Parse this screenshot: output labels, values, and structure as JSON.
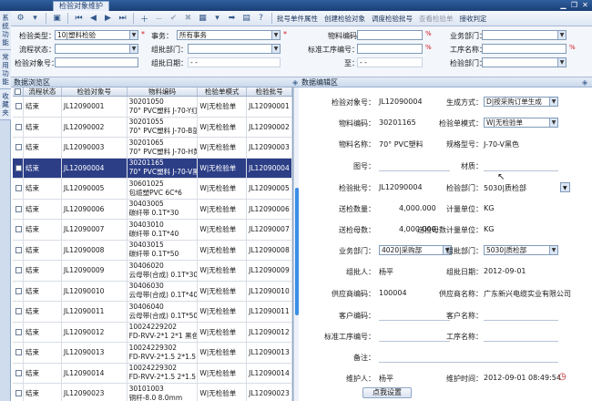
{
  "window": {
    "tab_title": "检验对象维护"
  },
  "sidebar": {
    "tabs": [
      "系统功能",
      "常用功能",
      "收藏夹"
    ]
  },
  "toolbar": {
    "texts": [
      "批号单件属性",
      "创建检验对象",
      "调度检验批号",
      "查看检验单",
      "接收判定"
    ]
  },
  "filter": {
    "labels": {
      "type": "检验类型：",
      "item": "事务：",
      "material_code": "物料编码：",
      "business_dept": "业务部门：",
      "flow_status": "流程状态：",
      "group_dept": "组批部门：",
      "std_process": "标准工序编号：",
      "process_name": "工序名称：",
      "object_no": "检验对象号：",
      "group_date": "组批日期：",
      "to": "至：",
      "check_dept": "检验部门："
    },
    "values": {
      "type": "10|塑料检验",
      "item": "所有事务",
      "date_from": "- -",
      "date_to": "- -"
    }
  },
  "panels": {
    "grid_title": "数据浏览区",
    "edit_title": "数据编辑区"
  },
  "grid": {
    "headers": [
      "流程状态",
      "检验对象号",
      "物料编码",
      "检验单模式",
      "检验批号"
    ],
    "rows": [
      {
        "status": "结束",
        "obj": "JL12090001",
        "mat1": "30201050",
        "mat2": "70° PVC塑料 J-70-Y红色",
        "mode": "W|无检验单",
        "batch": "JL12090001"
      },
      {
        "status": "结束",
        "obj": "JL12090002",
        "mat1": "30201055",
        "mat2": "70° PVC塑料 J-70-B蓝色",
        "mode": "W|无检验单",
        "batch": "JL12090002"
      },
      {
        "status": "结束",
        "obj": "JL12090003",
        "mat1": "30201065",
        "mat2": "70° PVC塑料 J-70-H黄色",
        "mode": "W|无检验单",
        "batch": "JL12090003"
      },
      {
        "status": "结束",
        "obj": "JL12090004",
        "mat1": "30201165",
        "mat2": "70° PVC塑料 J-70-V黑色",
        "mode": "W|无检验单",
        "batch": "JL12090004",
        "selected": true
      },
      {
        "status": "结束",
        "obj": "JL12090005",
        "mat1": "30601025",
        "mat2": "包缆塑PVC 6C*6",
        "mode": "W|无检验单",
        "batch": "JL12090005"
      },
      {
        "status": "结束",
        "obj": "JL12090006",
        "mat1": "30403005",
        "mat2": "碳纤带 0.1T*30",
        "mode": "W|无检验单",
        "batch": "JL12090006"
      },
      {
        "status": "结束",
        "obj": "JL12090007",
        "mat1": "30403010",
        "mat2": "碳纤带 0.1T*40",
        "mode": "W|无检验单",
        "batch": "JL12090007"
      },
      {
        "status": "结束",
        "obj": "JL12090008",
        "mat1": "30403015",
        "mat2": "碳纤带 0.1T*50",
        "mode": "W|无检验单",
        "batch": "JL12090008"
      },
      {
        "status": "结束",
        "obj": "JL12090009",
        "mat1": "30406020",
        "mat2": "云母带(合成) 0.1T*30mm",
        "mode": "W|无检验单",
        "batch": "JL12090009"
      },
      {
        "status": "结束",
        "obj": "JL12090010",
        "mat1": "30406030",
        "mat2": "云母带(合成) 0.1T*40mm",
        "mode": "W|无检验单",
        "batch": "JL12090010"
      },
      {
        "status": "结束",
        "obj": "JL12090011",
        "mat1": "30406040",
        "mat2": "云母带(合成) 0.1T*50mm",
        "mode": "W|无检验单",
        "batch": "JL12090011"
      },
      {
        "status": "结束",
        "obj": "JL12090012",
        "mat1": "10024229202",
        "mat2": "FD-RVV-2*1 2*1 黑色",
        "mode": "W|无检验单",
        "batch": "JL12090012"
      },
      {
        "status": "结束",
        "obj": "JL12090013",
        "mat1": "10024229302",
        "mat2": "FD-RVV-2*1.5 2*1.5 黑色",
        "mode": "W|无检验单",
        "batch": "JL12090013"
      },
      {
        "status": "结束",
        "obj": "JL12090014",
        "mat1": "10024229302",
        "mat2": "FD-RVV-2*1.5 2*1.5 黄色",
        "mode": "W|无检验单",
        "batch": "JL12090014"
      },
      {
        "status": "结束",
        "obj": "JL12090023",
        "mat1": "30101003",
        "mat2": "铜杆-8.0 8.0mm",
        "mode": "W|无检验单",
        "batch": "JL12090023"
      }
    ]
  },
  "edit": {
    "obj_no_label": "检验对象号：",
    "obj_no": "JL12090004",
    "gen_mode_label": "生成方式：",
    "gen_mode": "D|按采购订单生成",
    "mat_code_label": "物料编码：",
    "mat_code": "30201165",
    "sheet_mode_label": "检验单模式：",
    "sheet_mode": "W|无检验单",
    "mat_name_label": "物料名称：",
    "mat_name": "70° PVC塑料",
    "spec_label": "规格型号：",
    "spec": "J-70-V黑色",
    "drawing_label": "图号：",
    "texture_label": "材质：",
    "batch_label": "检验批号：",
    "batch": "JL12090004",
    "check_dept_label": "检验部门：",
    "check_dept": "5030|质检部",
    "send_qty_label": "送检数量：",
    "send_qty": "4,000.000",
    "unit_label": "计量单位：",
    "unit": "KG",
    "aux_qty_label": "送检母数：",
    "aux_qty": "4,000.000",
    "aux_unit_label": "送检母数计量单位：",
    "aux_unit": "KG",
    "biz_dept_label": "业务部门：",
    "biz_dept": "4020|采购部",
    "group_dept_label": "组批部门：",
    "group_dept": "5030|质检部",
    "grouper_label": "组批人：",
    "grouper": "杨平",
    "group_date_label": "组批日期：",
    "group_date": "2012-09-01",
    "supplier_code_label": "供应商编码：",
    "supplier_code": "100004",
    "supplier_name_label": "供应商名称：",
    "supplier_name": "广东新兴电缆实业有限公司",
    "cust_code_label": "客户编码：",
    "cust_name_label": "客户名称：",
    "std_proc_label": "标准工序编号：",
    "proc_name_label": "工序名称：",
    "remark_label": "备注：",
    "maintainer_label": "维护人：",
    "maintainer": "杨平",
    "maint_time_label": "维护时间：",
    "maint_time": "2012-09-01 08:49:54"
  },
  "footer": {
    "button": "点我设置"
  }
}
